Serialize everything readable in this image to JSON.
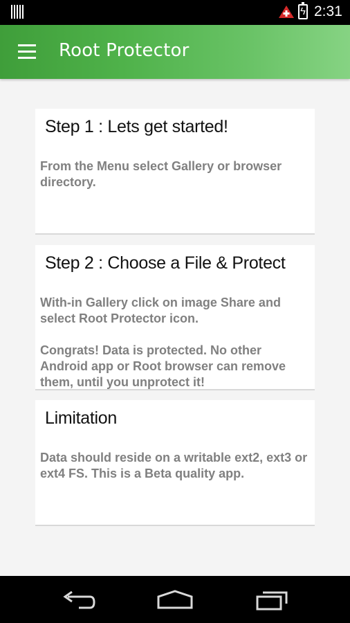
{
  "status_bar": {
    "time": "2:31",
    "icons": [
      "barcode-icon",
      "warning-icon",
      "battery-charging-icon"
    ]
  },
  "app_bar": {
    "title": "Root Protector",
    "menu_icon": "hamburger-menu-icon"
  },
  "cards": [
    {
      "title": "Step 1 : Lets get started!",
      "body": " From the Menu select Gallery or browser directory."
    },
    {
      "title": "Step 2 : Choose a File & Protect",
      "body": " With-in Gallery click on image Share and select Root Protector icon.\n\n Congrats! Data is protected. No other Android app or Root browser can remove them, until you unprotect it!"
    },
    {
      "title": "Limitation",
      "body": " Data should reside on a writable ext2, ext3 or ext4 FS. This is a Beta quality app."
    }
  ],
  "nav_bar": {
    "icons": [
      "back-icon",
      "home-icon",
      "recents-icon"
    ]
  },
  "colors": {
    "accent_green": "#4fb24a",
    "body_text": "#808080"
  }
}
